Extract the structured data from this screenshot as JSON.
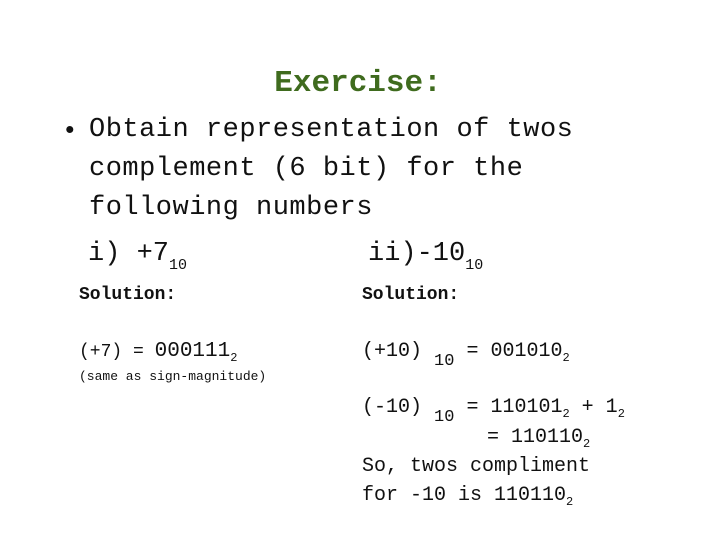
{
  "title": {
    "text": "Exercise:",
    "color": "#3f6b1e"
  },
  "bullet": {
    "icon": "bullet-dot",
    "lines": [
      "Obtain representation of twos",
      "complement (6 bit) for the",
      "following numbers"
    ]
  },
  "items": [
    {
      "label": "i) +7",
      "subscript": "10"
    },
    {
      "label": "ii)-10",
      "subscript": "10"
    }
  ],
  "solutions": [
    {
      "label": "Solution:",
      "equation": {
        "lhs": "(+7) = ",
        "value": "000111",
        "base": "2"
      },
      "note": "(same as sign-magnitude)"
    },
    {
      "label": "Solution:",
      "steps": [
        {
          "lhs": "(+10)",
          "lhs_sub": "10",
          "eq": " = ",
          "value": "001010",
          "base": "2"
        },
        {
          "lhs": "(-10)",
          "lhs_sub": "10",
          "eq": " = ",
          "value": "110101",
          "base": "2",
          "plus": " + 1",
          "plus_base": "2"
        },
        {
          "eq": "= ",
          "value": "110110",
          "base": "2"
        }
      ],
      "conclusion": [
        "So, twos compliment",
        {
          "text": "for -10 is ",
          "value": "110110",
          "base": "2"
        }
      ]
    }
  ]
}
